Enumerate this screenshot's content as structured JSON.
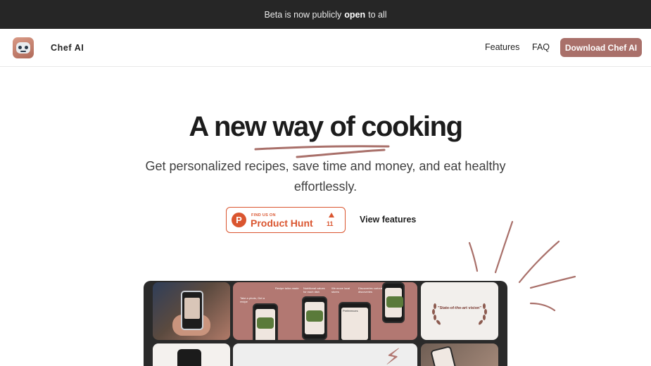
{
  "banner": {
    "text_before": "Beta is now publicly",
    "text_bold": "open",
    "text_after": "to all"
  },
  "nav": {
    "brand": "Chef AI",
    "links": [
      "Features",
      "FAQ"
    ],
    "cta": "Download Chef AI",
    "logo_icon": "robot-chef-icon"
  },
  "hero": {
    "title": "A new way of cooking",
    "subtitle": "Get personalized recipes, save time and money, and eat healthy effortlessly.",
    "accent_color": "#a9706a"
  },
  "product_hunt": {
    "small_label": "FIND US ON",
    "big_label": "Product Hunt",
    "upvotes": "11",
    "logo_letter": "P",
    "color": "#da552f"
  },
  "secondary_cta": "View features",
  "gallery": {
    "captions": [
      "Take a photo, Get a recipe",
      "Recipe tailor-made",
      "Nutritional values for each dish",
      "We move local stores",
      "Discoveries curious discoveries"
    ],
    "preferences_label": "Preferences",
    "award_quote": "\"State-of-the-art vision\""
  }
}
